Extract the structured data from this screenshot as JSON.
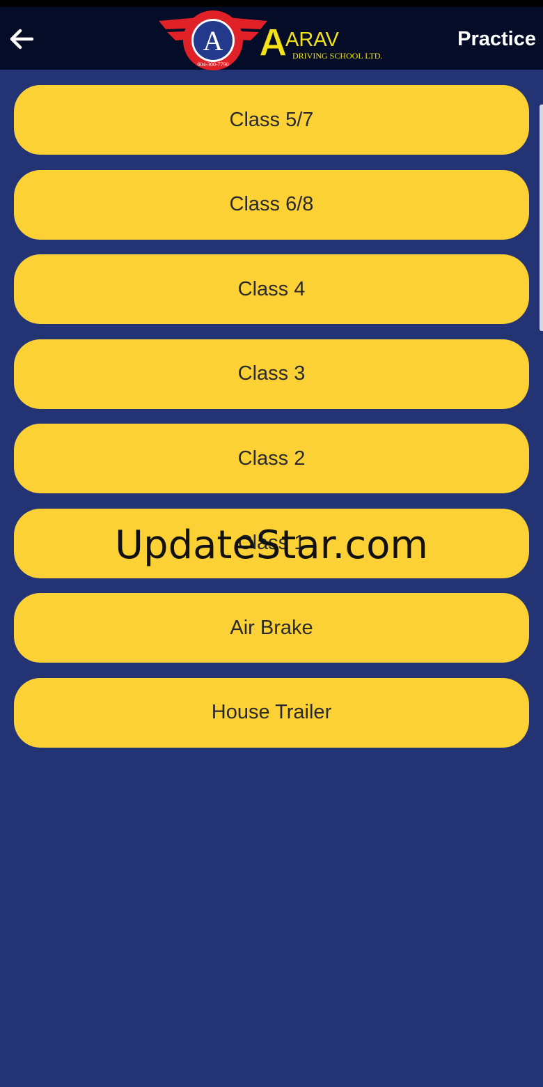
{
  "app_bar": {
    "logo_wordmark": "ARAV",
    "logo_subtitle": "DRIVING SCHOOL LTD.",
    "logo_seal_text": "AARAV DRIVING SCHOOL LTD.",
    "logo_phone": "604-300-7790",
    "title": "Practice"
  },
  "classes": [
    {
      "label": "Class 5/7"
    },
    {
      "label": "Class 6/8"
    },
    {
      "label": "Class 4"
    },
    {
      "label": "Class 3"
    },
    {
      "label": "Class 2"
    },
    {
      "label": "Class 1"
    },
    {
      "label": "Air Brake"
    },
    {
      "label": "House Trailer"
    }
  ],
  "watermark": "UpdateStar.com",
  "colors": {
    "background": "#243373",
    "app_bar": "#050c28",
    "button": "#fcd136",
    "button_text": "#2a2a2a",
    "logo_yellow": "#f3e21a",
    "logo_red": "#e02127"
  },
  "icons": {
    "back": "arrow-left-icon"
  }
}
